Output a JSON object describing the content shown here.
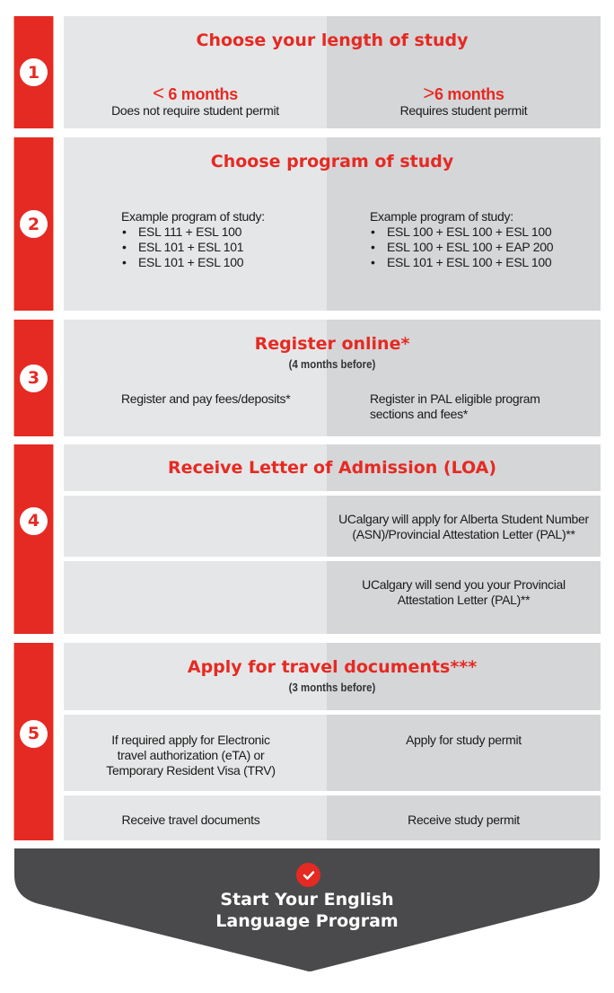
{
  "colors": {
    "accent": "#e52a23",
    "panel_left": "#e5e6e7",
    "panel_right": "#d5d6d8",
    "final_bg": "#4a4a4c"
  },
  "steps": [
    {
      "number": "1",
      "title": "Choose your length of study",
      "left": {
        "heading_symbol": "<",
        "heading": "6 months",
        "text": "Does not require student permit"
      },
      "right": {
        "heading_symbol": ">",
        "heading": "6 months",
        "text": "Requires student permit"
      }
    },
    {
      "number": "2",
      "title": "Choose program of study",
      "left": {
        "intro": "Example program of study:",
        "items": [
          "ESL 111 + ESL 100",
          "ESL 101 + ESL 101",
          "ESL 101 + ESL 100"
        ]
      },
      "right": {
        "intro": "Example program of study:",
        "items": [
          "ESL 100 + ESL 100 + ESL 100",
          "ESL 100 + ESL 100 + EAP 200",
          "ESL 101 + ESL 100 + ESL 100"
        ]
      }
    },
    {
      "number": "3",
      "title": "Register online*",
      "subtitle": "(4 months before)",
      "left": {
        "text": "Register and pay fees/deposits*"
      },
      "right": {
        "line1": "Register in PAL eligible program",
        "line2": "sections and fees*"
      }
    },
    {
      "number": "4",
      "title": "Receive Letter of Admission (LOA)",
      "rows": [
        {
          "left": "",
          "right_line1": "UCalgary will apply for Alberta Student Number",
          "right_line2": "(ASN)/Provincial Attestation Letter (PAL)**"
        },
        {
          "left": "",
          "right_line1": "UCalgary will send you your Provincial",
          "right_line2": "Attestation Letter (PAL)**"
        }
      ]
    },
    {
      "number": "5",
      "title": "Apply for travel documents***",
      "subtitle": "(3 months before)",
      "rows": [
        {
          "left_line1": "If required apply for Electronic",
          "left_line2": "travel authorization (eTA) or",
          "left_line3": "Temporary Resident Visa (TRV)",
          "right": "Apply for study permit"
        },
        {
          "left": "Receive travel documents",
          "right": "Receive study permit"
        }
      ]
    }
  ],
  "final": {
    "icon": "check-icon",
    "line1": "Start Your English",
    "line2": "Language Program"
  }
}
